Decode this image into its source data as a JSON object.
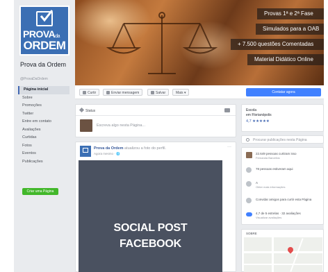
{
  "page": {
    "name": "Prova da Ordem",
    "handle": "@ProvaDaOrdem",
    "logo": {
      "line1": "PROVA",
      "line1_small": "da",
      "line2": "ORDEM"
    }
  },
  "sidebar": {
    "items": [
      {
        "label": "Página inicial",
        "active": true
      },
      {
        "label": "Sobre"
      },
      {
        "label": "Promoções"
      },
      {
        "label": "Twitter"
      },
      {
        "label": "Entre em contato"
      },
      {
        "label": "Avaliações"
      },
      {
        "label": "Curtidas"
      },
      {
        "label": "Fotos"
      },
      {
        "label": "Eventos"
      },
      {
        "label": "Publicações"
      }
    ],
    "create_page_label": "Criar uma Página"
  },
  "cover": {
    "banners": [
      "Provas 1ª e 2ª Fase",
      "Simulados para a OAB",
      "+ 7.500 questões Comentadas",
      "Material Didático Online"
    ]
  },
  "actions": {
    "like": "Curtir",
    "message": "Enviar mensagem",
    "save": "Salvar",
    "more": "Mais ▾",
    "contact": "Contatar agora"
  },
  "composer": {
    "tab": "Status",
    "placeholder": "Escreva algo nesta Página..."
  },
  "post": {
    "author": "Prova da Ordem",
    "action": "atualizou a foto do perfil.",
    "meta": "Agora mesmo · 🌐",
    "more": "···",
    "caption_line1": "SOCIAL POST",
    "caption_line2": "FACEBOOK"
  },
  "info": {
    "category1": "Escola",
    "category2": "em Florianópolis",
    "rating": "4,7 ★★★★★"
  },
  "search": {
    "placeholder": "Procurar publicações nesta Página"
  },
  "about": {
    "rows": [
      {
        "t1": "22.649 pessoas curtiram isso",
        "t2": "Fernanda Barcellos"
      },
      {
        "t1": "78 pessoas estiveram aqui",
        "t2": ""
      },
      {
        "t1": "A",
        "t2": "Obter mais informações"
      },
      {
        "t1": "Convidar amigos para curtir esta Página",
        "t2": ""
      },
      {
        "t1": "4,7 de 5 estrelas · 32 avaliações",
        "t2": "Visualizar avaliações"
      }
    ]
  },
  "map": {
    "title": "SOBRE"
  },
  "colors": {
    "brand": "#3b6fb4",
    "primary_button": "#4080ff",
    "create_button": "#42b72a",
    "page_bg": "#e9ebee",
    "post_image": "#4a5160"
  }
}
